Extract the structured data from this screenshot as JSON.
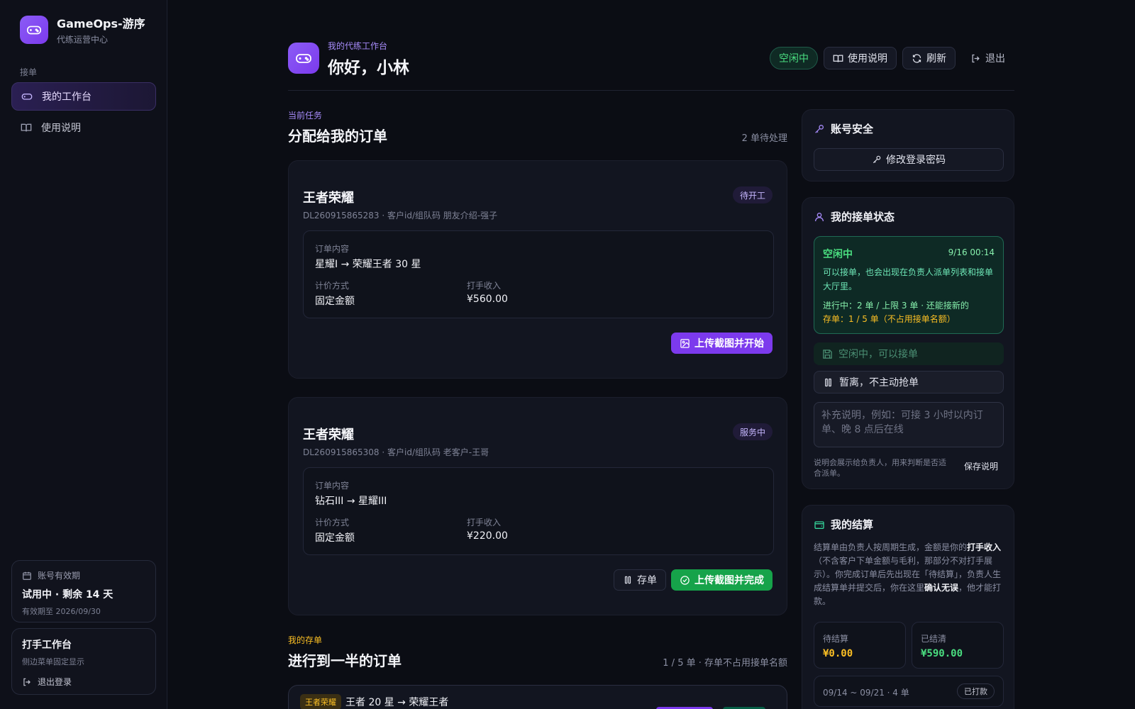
{
  "brand": {
    "name": "GameOps-游序",
    "subtitle": "代练运营中心"
  },
  "sidebar": {
    "section": "接单",
    "items": [
      {
        "label": "我的工作台",
        "icon": "gamepad-icon",
        "active": true
      },
      {
        "label": "使用说明",
        "icon": "book-icon",
        "active": false
      }
    ],
    "account": {
      "label": "账号有效期",
      "title": "试用中 · 剩余 14 天",
      "expiry": "有效期至 2026/09/30"
    },
    "workbench": {
      "title": "打手工作台",
      "sub": "侧边菜单固定显示",
      "logout": "退出登录"
    }
  },
  "header": {
    "kicker": "我的代练工作台",
    "title": "你好，小林",
    "status": "空闲中",
    "help": "使用说明",
    "refresh": "刷新",
    "logout": "退出"
  },
  "orders_section": {
    "kicker": "当前任务",
    "title": "分配给我的订单",
    "count": "2 单待处理"
  },
  "orders": [
    {
      "game": "王者荣耀",
      "meta": "DL260915865283 · 客户id/组队码 朋友介绍-强子",
      "badge": "待开工",
      "content_label": "订单内容",
      "content": "星耀I → 荣耀王者 30 星",
      "pricing_label": "计价方式",
      "pricing": "固定金额",
      "income_label": "打手收入",
      "income": "¥560.00",
      "action": "上传截图并开始"
    },
    {
      "game": "王者荣耀",
      "meta": "DL260915865308 · 客户id/组队码 老客户-王哥",
      "badge": "服务中",
      "content_label": "订单内容",
      "content": "钻石III → 星耀III",
      "pricing_label": "计价方式",
      "pricing": "固定金额",
      "income_label": "打手收入",
      "income": "¥220.00",
      "stash": "存单",
      "action": "上传截图并完成"
    }
  ],
  "stash_section": {
    "kicker": "我的存单",
    "title": "进行到一半的订单",
    "meta": "1 / 5 单 · 存单不占用接单名额",
    "item": {
      "tag": "王者荣耀",
      "title": "王者 20 星 → 荣耀王者"
    }
  },
  "security": {
    "title": "账号安全",
    "button": "修改登录密码"
  },
  "work_status": {
    "title": "我的接单状态",
    "state": "空闲中",
    "time": "9/16 00:14",
    "desc": "可以接单，也会出现在负责人派单列表和接单大厅里。",
    "line1": "进行中：2 单 / 上限 3 单 · 还能接新的",
    "line2": "存单：1 / 5 单（不占用接单名额）",
    "option_idle": "空闲中，可以接单",
    "option_away": "暂离，不主动抢单",
    "note_placeholder": "补充说明，例如：可接 3 小时以内订单、晚 8 点后在线",
    "note_help": "说明会展示给负责人，用来判断是否适合派单。",
    "save": "保存说明"
  },
  "settlement": {
    "title": "我的结算",
    "desc_1": "结算单由负责人按周期生成，金额是你的",
    "desc_b1": "打手收入",
    "desc_2": "（不含客户下单金额与毛利，那部分不对打手展示）。你完成订单后先出现在「待结算」，负责人生成结算单并提交后，你在这里",
    "desc_b2": "确认无误",
    "desc_3": "，他才能打款。",
    "pending_label": "待结算",
    "pending": "¥0.00",
    "settled_label": "已结清",
    "settled": "¥590.00",
    "period": "09/14 ~ 09/21 · 4 单",
    "period_status": "已打款"
  },
  "colors": {
    "accent": "#7c3aed",
    "success": "#16a34a",
    "warning": "#fbbf24",
    "bg": "#0b0d14"
  }
}
